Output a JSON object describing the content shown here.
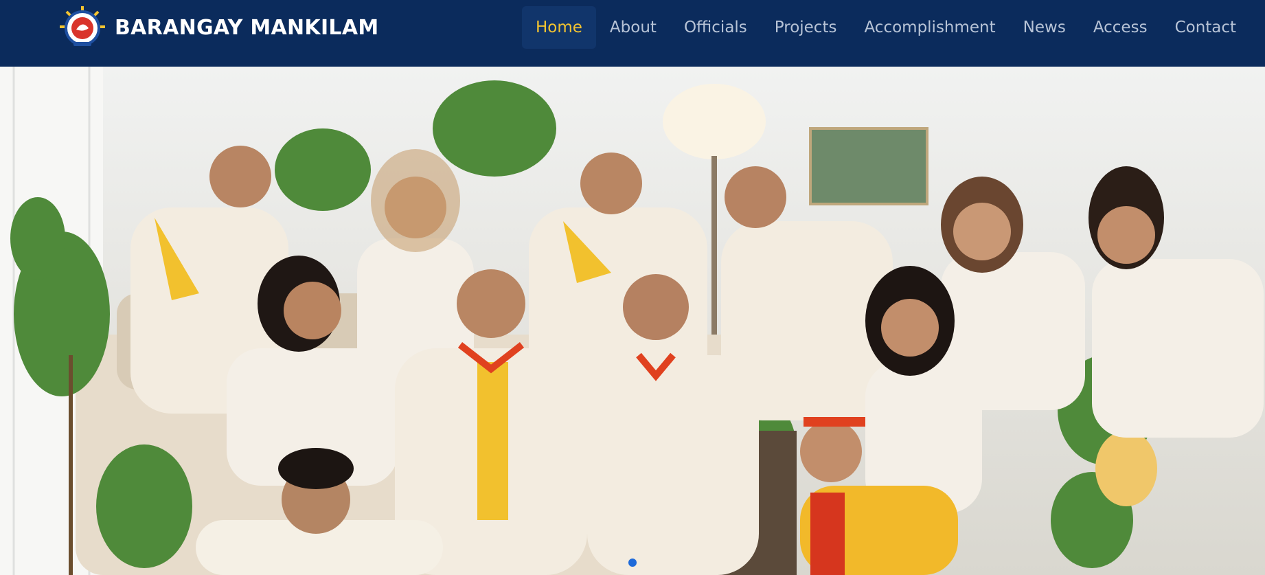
{
  "brand": {
    "name": "BARANGAY MANKILAM",
    "logo_icon": "barangay-seal-logo"
  },
  "nav": {
    "items": [
      {
        "label": "Home",
        "active": true
      },
      {
        "label": "About",
        "active": false
      },
      {
        "label": "Officials",
        "active": false
      },
      {
        "label": "Projects",
        "active": false
      },
      {
        "label": "Accomplishment",
        "active": false
      },
      {
        "label": "News",
        "active": false
      },
      {
        "label": "Access",
        "active": false
      },
      {
        "label": "Contact",
        "active": false
      }
    ]
  },
  "hero": {
    "slide_count": 1,
    "active_slide": 1
  },
  "colors": {
    "navbar_bg": "#0b2b5c",
    "active_link": "#f4c430",
    "link": "#b7c3d6",
    "brand_text": "#ffffff",
    "indicator": "#1e6ad9"
  }
}
